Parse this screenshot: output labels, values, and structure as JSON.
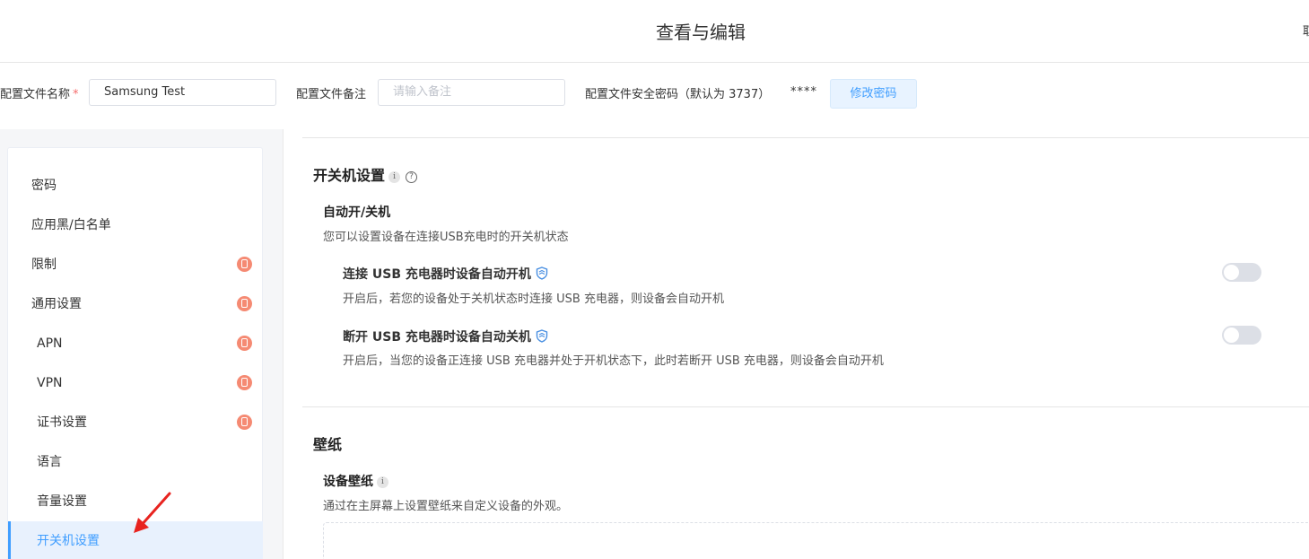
{
  "header": {
    "title": "查看与编辑",
    "cut_text": "取"
  },
  "form": {
    "name_label": "配置文件名称",
    "required_mark": "*",
    "name_value": "Samsung Test",
    "remark_label": "配置文件备注",
    "remark_placeholder": "请输入备注",
    "password_label": "配置文件安全密码（默认为 3737）",
    "password_masked": "****",
    "change_password_button": "修改密码"
  },
  "sidebar": {
    "items": [
      {
        "label": "密码",
        "badge": false,
        "active": false
      },
      {
        "label": "应用黑/白名单",
        "badge": false,
        "active": false
      },
      {
        "label": "限制",
        "badge": true,
        "active": false
      },
      {
        "label": "通用设置",
        "badge": true,
        "active": false
      },
      {
        "label": "APN",
        "badge": true,
        "active": false
      },
      {
        "label": "VPN",
        "badge": true,
        "active": false
      },
      {
        "label": "证书设置",
        "badge": true,
        "active": false
      },
      {
        "label": "语言",
        "badge": false,
        "active": false
      },
      {
        "label": "音量设置",
        "badge": false,
        "active": false
      },
      {
        "label": "开关机设置",
        "badge": false,
        "active": true
      }
    ]
  },
  "power_section": {
    "title": "开关机设置",
    "info_glyph": "i",
    "help_glyph": "?",
    "subtitle": "自动开/关机",
    "description": "您可以设置设备在连接USB充电时的开关机状态",
    "options": [
      {
        "title": "连接 USB 充电器时设备自动开机",
        "description": "开启后，若您的设备处于关机状态时连接 USB 充电器，则设备会自动开机",
        "enabled": false
      },
      {
        "title": "断开 USB 充电器时设备自动关机",
        "description": "开启后，当您的设备正连接 USB 充电器并处于开机状态下，此时若断开 USB 充电器，则设备会自动开机",
        "enabled": false
      }
    ]
  },
  "wallpaper_section": {
    "title": "壁纸",
    "subtitle": "设备壁纸",
    "info_glyph": "i",
    "description": "通过在主屏幕上设置壁纸来自定义设备的外观。"
  },
  "colors": {
    "accent": "#409eff",
    "badge": "#f58a73",
    "arrow": "#e8231f",
    "toggle_off": "#dcdfe6"
  }
}
